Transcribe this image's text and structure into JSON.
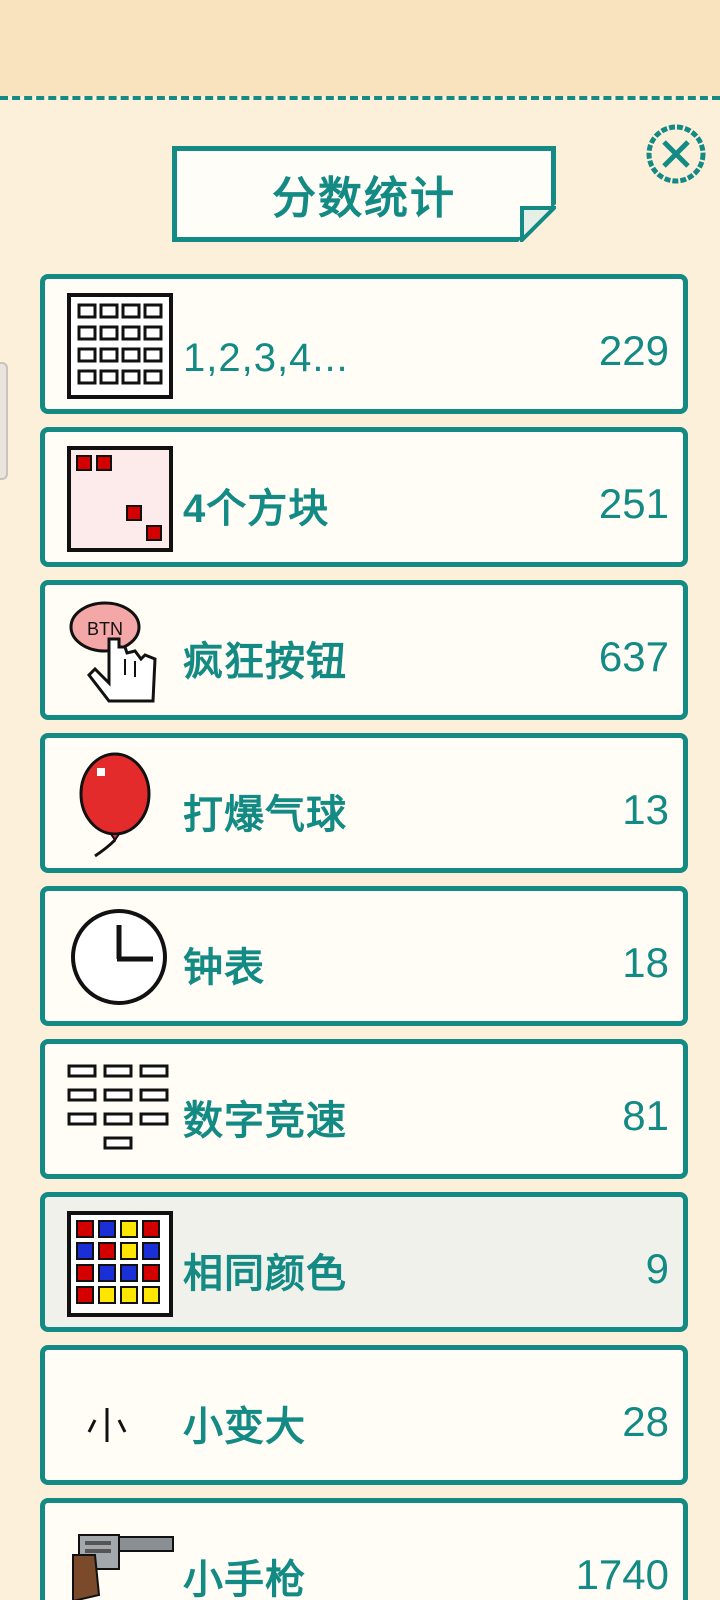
{
  "header": {
    "title": "分数统计"
  },
  "close": {
    "icon": "close-icon"
  },
  "colors": {
    "accent": "#138a84",
    "panel": "#fdf0db",
    "top": "#f9e3bf"
  },
  "rows": [
    {
      "icon": "number-grid-icon",
      "label": "1,2,3,4...",
      "score": "229"
    },
    {
      "icon": "four-blocks-icon",
      "label": "4个方块",
      "score": "251"
    },
    {
      "icon": "btn-pointer-icon",
      "label": "疯狂按钮",
      "score": "637"
    },
    {
      "icon": "balloon-icon",
      "label": "打爆气球",
      "score": "13"
    },
    {
      "icon": "clock-icon",
      "label": "钟表",
      "score": "18"
    },
    {
      "icon": "number-keys-icon",
      "label": "数字竞速",
      "score": "81"
    },
    {
      "icon": "color-grid-icon",
      "label": "相同颜色",
      "score": "9"
    },
    {
      "icon": "small-to-big-icon",
      "label": "小变大",
      "score": "28"
    },
    {
      "icon": "revolver-icon",
      "label": "小手枪",
      "score": "1740"
    }
  ]
}
